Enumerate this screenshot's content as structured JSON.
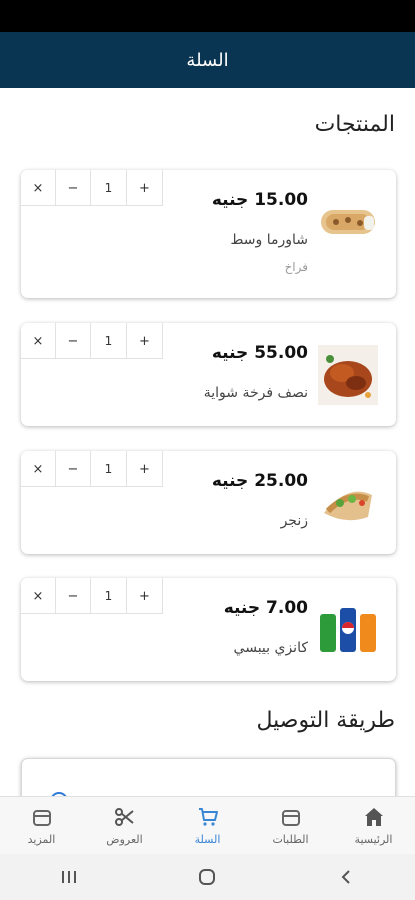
{
  "header": {
    "title": "السلة"
  },
  "sections": {
    "products": "المنتجات",
    "delivery": "طريقة التوصيل"
  },
  "qty_controls": {
    "plus": "+",
    "minus": "−",
    "remove": "×"
  },
  "cart": [
    {
      "price": "15.00 جنيه",
      "name": "شاورما وسط",
      "note": "فراخ",
      "qty": "1",
      "image": "shawarma-image"
    },
    {
      "price": "55.00 جنيه",
      "name": "نصف فرخة شواية",
      "note": "",
      "qty": "1",
      "image": "grilled-chicken-image"
    },
    {
      "price": "25.00 جنيه",
      "name": "زنجر",
      "note": "",
      "qty": "1",
      "image": "zinger-wrap-image"
    },
    {
      "price": "7.00 جنيه",
      "name": "كانزي بيبسي",
      "note": "",
      "qty": "1",
      "image": "pepsi-cans-image"
    }
  ],
  "bottom_nav": [
    {
      "label": "الرئيسية",
      "icon": "home-icon",
      "active": false
    },
    {
      "label": "الطلبات",
      "icon": "orders-icon",
      "active": false
    },
    {
      "label": "السلة",
      "icon": "cart-icon",
      "active": true
    },
    {
      "label": "العروض",
      "icon": "scissors-icon",
      "active": false
    },
    {
      "label": "المزيد",
      "icon": "more-icon",
      "active": false
    }
  ],
  "colors": {
    "app_bar": "#0a3552",
    "accent": "#3a86d6"
  }
}
